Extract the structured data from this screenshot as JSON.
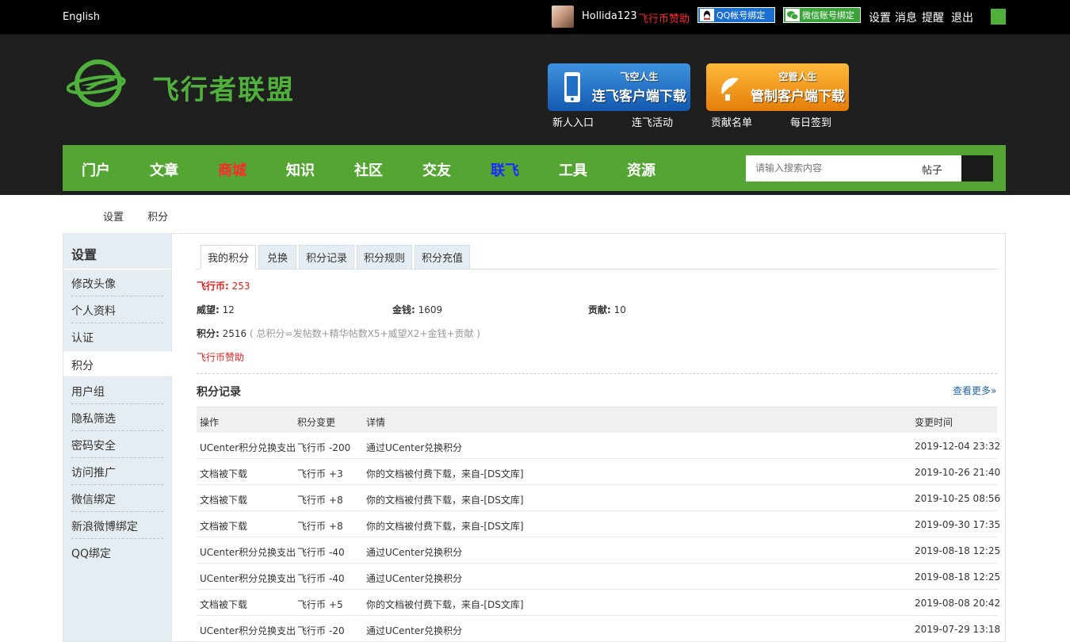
{
  "topbar": {
    "language": "English",
    "username": "Hollida123",
    "sponsor": "飞行币赞助",
    "qq_bind": "QQ帐号绑定",
    "wechat_bind": "微信账号绑定",
    "links": [
      "设置",
      "消息",
      "提醒",
      "退出"
    ]
  },
  "header": {
    "logo_text": "飞行者联盟",
    "download_buttons": [
      {
        "sub": "飞空人生",
        "main": "连飞客户端下载"
      },
      {
        "sub": "空管人生",
        "main": "管制客户端下载"
      }
    ],
    "links": [
      "新人入口",
      "连飞活动",
      "贡献名单",
      "每日签到"
    ]
  },
  "nav": {
    "items": [
      {
        "label": "门户",
        "color": "#ffffff"
      },
      {
        "label": "文章",
        "color": "#ffffff"
      },
      {
        "label": "商城",
        "color": "#ff2a2a"
      },
      {
        "label": "知识",
        "color": "#ffffff"
      },
      {
        "label": "社区",
        "color": "#ffffff"
      },
      {
        "label": "交友",
        "color": "#ffffff"
      },
      {
        "label": "联飞",
        "color": "#1a2bff"
      },
      {
        "label": "工具",
        "color": "#ffffff"
      },
      {
        "label": "资源",
        "color": "#ffffff"
      }
    ],
    "search_placeholder": "请输入搜索内容",
    "search_type": "帖子"
  },
  "breadcrumb": [
    "设置",
    "积分"
  ],
  "sidebar": {
    "title": "设置",
    "items": [
      "修改头像",
      "个人资料",
      "认证",
      "积分",
      "用户组",
      "隐私筛选",
      "密码安全",
      "访问推广",
      "微信绑定",
      "新浪微博绑定",
      "QQ绑定"
    ],
    "active_index": 3
  },
  "tabs": [
    "我的积分",
    "兑换",
    "积分记录",
    "积分规则",
    "积分充值"
  ],
  "credits": {
    "coin_label": "飞行币:",
    "coin_value": "253",
    "prestige_label": "威望:",
    "prestige_value": "12",
    "money_label": "金钱:",
    "money_value": "1609",
    "contribution_label": "贡献:",
    "contribution_value": "10",
    "total_label": "积分:",
    "total_value": "2516",
    "total_rule": "( 总积分=发帖数+精华帖数X5+威望X2+金钱+贡献 )",
    "sponsor_link": "飞行币赞助"
  },
  "records": {
    "title": "积分记录",
    "more": "查看更多»",
    "headers": [
      "操作",
      "积分变更",
      "详情",
      "变更时间"
    ],
    "rows": [
      {
        "action": "UCenter积分兑换支出",
        "currency": "飞行币",
        "change": "-200",
        "detail": "通过UCenter兑换积分",
        "time": "2019-12-04 23:32"
      },
      {
        "action": "文档被下载",
        "currency": "飞行币",
        "change": "+3",
        "detail": "你的文档被付费下载，来自-[DS文库]",
        "time": "2019-10-26 21:40"
      },
      {
        "action": "文档被下载",
        "currency": "飞行币",
        "change": "+8",
        "detail": "你的文档被付费下载，来自-[DS文库]",
        "time": "2019-10-25 08:56"
      },
      {
        "action": "文档被下载",
        "currency": "飞行币",
        "change": "+8",
        "detail": "你的文档被付费下载，来自-[DS文库]",
        "time": "2019-09-30 17:35"
      },
      {
        "action": "UCenter积分兑换支出",
        "currency": "飞行币",
        "change": "-40",
        "detail": "通过UCenter兑换积分",
        "time": "2019-08-18 12:25"
      },
      {
        "action": "UCenter积分兑换支出",
        "currency": "飞行币",
        "change": "-40",
        "detail": "通过UCenter兑换积分",
        "time": "2019-08-18 12:25"
      },
      {
        "action": "文档被下载",
        "currency": "飞行币",
        "change": "+5",
        "detail": "你的文档被付费下载，来自-[DS文库]",
        "time": "2019-08-08 20:42"
      },
      {
        "action": "UCenter积分兑换支出",
        "currency": "飞行币",
        "change": "-20",
        "detail": "通过UCenter兑换积分",
        "time": "2019-07-29 13:18"
      }
    ]
  },
  "colors": {
    "brand_green": "#55a534",
    "negative": "#999999",
    "positive": "#e02020"
  }
}
